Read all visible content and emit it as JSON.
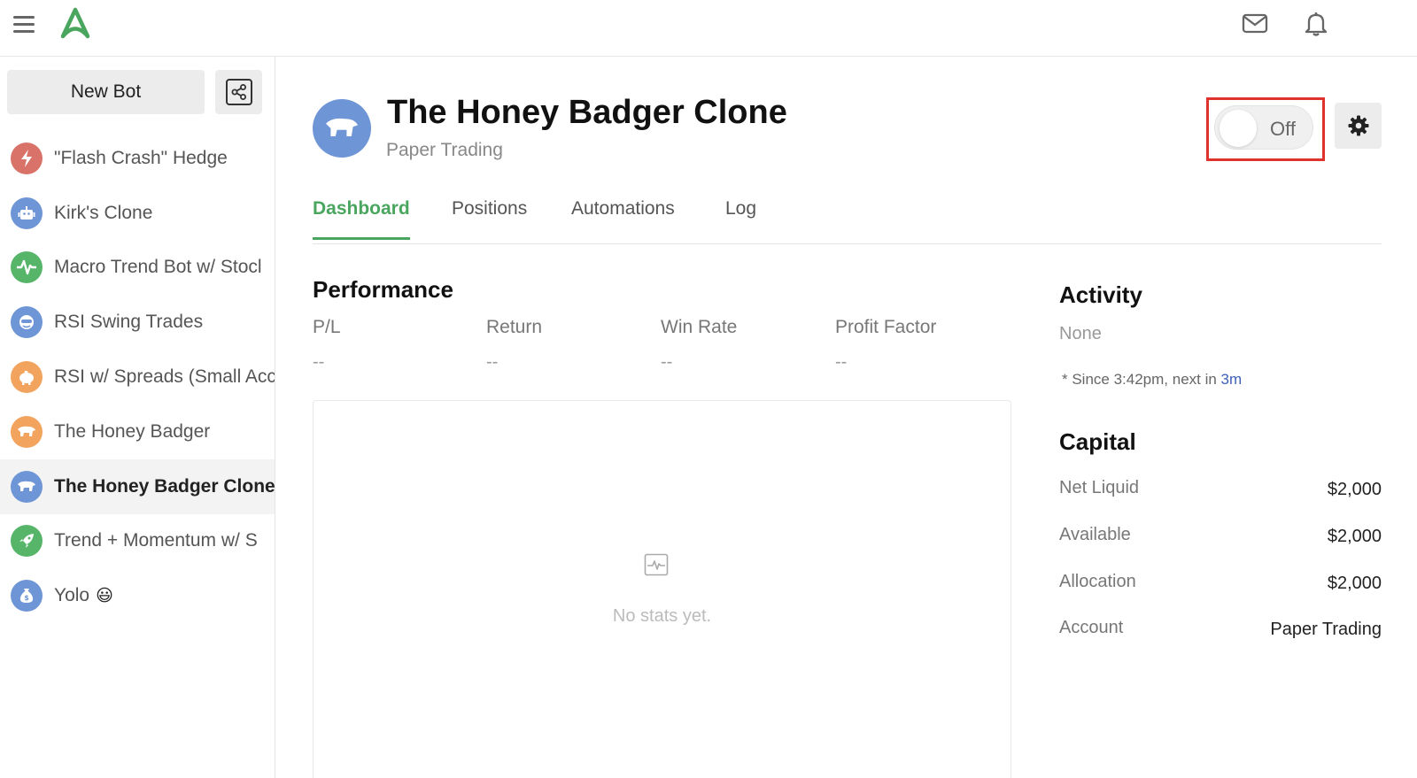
{
  "topbar": {
    "menu_icon": "hamburger-menu-icon",
    "logo_icon": "app-logo-icon",
    "mail_icon": "mail-icon",
    "bell_icon": "bell-icon"
  },
  "sidebar": {
    "new_bot_label": "New Bot",
    "share_icon": "share-icon",
    "bots": [
      {
        "name": "\"Flash Crash\" Hedge",
        "icon": "lightning-bolt-icon",
        "color": "#d9736a"
      },
      {
        "name": "Kirk's Clone",
        "icon": "robot-icon",
        "color": "#6e95d6"
      },
      {
        "name": "Macro Trend Bot w/ Stocl",
        "icon": "heartbeat-icon",
        "color": "#57b56a"
      },
      {
        "name": "RSI Swing Trades",
        "icon": "face-icon",
        "color": "#6e95d6"
      },
      {
        "name": "RSI w/ Spreads (Small Acc",
        "icon": "piggy-bank-icon",
        "color": "#f2a45f"
      },
      {
        "name": "The Honey Badger",
        "icon": "badger-icon",
        "color": "#f2a45f"
      },
      {
        "name": "The Honey Badger Clone",
        "icon": "badger-icon",
        "color": "#6e95d6",
        "active": true
      },
      {
        "name": "Trend + Momentum w/ S",
        "icon": "rocket-icon",
        "color": "#57b56a"
      },
      {
        "name": "Yolo",
        "icon": "money-bag-icon",
        "color": "#6e95d6",
        "emoji": "😃"
      }
    ]
  },
  "header": {
    "title": "The Honey Badger Clone",
    "subtitle": "Paper Trading",
    "toggle_label": "Off",
    "settings_icon": "gear-icon"
  },
  "tabs": [
    "Dashboard",
    "Positions",
    "Automations",
    "Log"
  ],
  "performance": {
    "title": "Performance",
    "stats": [
      {
        "label": "P/L",
        "value": "--"
      },
      {
        "label": "Return",
        "value": "--"
      },
      {
        "label": "Win Rate",
        "value": "--"
      },
      {
        "label": "Profit Factor",
        "value": "--"
      }
    ],
    "empty_text": "No stats yet."
  },
  "activity": {
    "title": "Activity",
    "none_text": "None",
    "since_text": "* Since 3:42pm, next in ",
    "next_link": "3m"
  },
  "capital": {
    "title": "Capital",
    "rows": [
      {
        "label": "Net Liquid",
        "value": "$2,000"
      },
      {
        "label": "Available",
        "value": "$2,000"
      },
      {
        "label": "Allocation",
        "value": "$2,000"
      },
      {
        "label": "Account",
        "value": "Paper Trading"
      }
    ]
  },
  "colors": {
    "accent_green": "#4aa65f",
    "highlight_red": "#e0322c",
    "link_blue": "#3d5fb8"
  }
}
